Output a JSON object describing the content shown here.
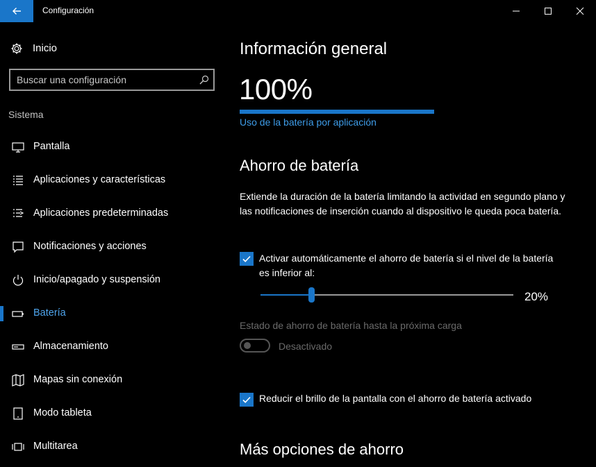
{
  "window": {
    "title": "Configuración"
  },
  "sidebar": {
    "home_label": "Inicio",
    "search": {
      "placeholder": "Buscar una configuración"
    },
    "section_title": "Sistema",
    "items": [
      {
        "label": "Pantalla",
        "icon": "monitor-icon"
      },
      {
        "label": "Aplicaciones y características",
        "icon": "apps-list-icon"
      },
      {
        "label": "Aplicaciones predeterminadas",
        "icon": "default-apps-icon"
      },
      {
        "label": "Notificaciones y acciones",
        "icon": "notification-icon"
      },
      {
        "label": "Inicio/apagado y suspensión",
        "icon": "power-icon"
      },
      {
        "label": "Batería",
        "icon": "battery-icon",
        "active": true
      },
      {
        "label": "Almacenamiento",
        "icon": "storage-icon"
      },
      {
        "label": "Mapas sin conexión",
        "icon": "map-icon"
      },
      {
        "label": "Modo tableta",
        "icon": "tablet-icon"
      },
      {
        "label": "Multitarea",
        "icon": "multitask-icon"
      }
    ]
  },
  "main": {
    "info_heading": "Información general",
    "battery_percent": "100%",
    "battery_level": 1.0,
    "usage_link": "Uso de la batería por aplicación",
    "saver_heading": "Ahorro de batería",
    "saver_description": "Extiende la duración de la batería limitando la actividad en segundo plano y las notificaciones de inserción cuando al dispositivo le queda poca batería.",
    "auto_saver_checkbox": {
      "label": "Activar automáticamente el ahorro de batería si el nivel de la batería es inferior al:",
      "checked": true
    },
    "threshold_slider": {
      "value": 20,
      "display": "20%"
    },
    "status_label": "Estado de ahorro de batería hasta la próxima carga",
    "status_toggle": {
      "label": "Desactivado",
      "on": false
    },
    "dim_checkbox": {
      "label": "Reducir el brillo de la pantalla con el ahorro de batería activado",
      "checked": true
    },
    "more_heading": "Más opciones de ahorro"
  },
  "colors": {
    "accent": "#1a76c9",
    "link": "#3e9ce8",
    "background": "#000000",
    "disabled_text": "#6a6a6a"
  }
}
